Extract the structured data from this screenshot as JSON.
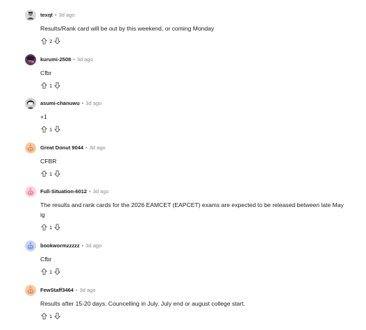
{
  "comments": [
    {
      "username": "texqt",
      "time": "3d ago",
      "text": "Results/Rank card will be out by this weekend, or coming Monday",
      "score": "2",
      "avatar_color": "#8a8a8a"
    },
    {
      "username": "kurumi-2508",
      "time": "3d ago",
      "text": "Cfbr",
      "score": "1",
      "avatar_color": "#5a3b5e"
    },
    {
      "username": "asumi-chanuwu",
      "time": "3d ago",
      "text": "+1",
      "score": "1",
      "avatar_color": "#6e6e6e"
    },
    {
      "username": "Great Donut 9044",
      "time": "3d ago",
      "text": "CFBR",
      "score": "1",
      "avatar_color": "#e8975c"
    },
    {
      "username": "Full-Situation-6012",
      "time": "3d ago",
      "text": "The results and rank cards for the 2026 EAMCET (EAPCET) exams are expected to be released between late May",
      "text2": "ig",
      "score": "1",
      "avatar_color": "#f08ca0"
    },
    {
      "username": "bookwormzzzzz",
      "time": "3d ago",
      "text": "Cfbr",
      "score": "1",
      "avatar_color": "#7f9fe0"
    },
    {
      "username": "FewStaff3464",
      "time": "3d ago",
      "text": "Results after 15-20 days. Councelling in July. July end or august college start.",
      "score": "1",
      "avatar_color": "#e8975c"
    }
  ],
  "separator": "•",
  "icons": {
    "upvote": "upvote-arrow-icon",
    "downvote": "downvote-arrow-icon"
  }
}
